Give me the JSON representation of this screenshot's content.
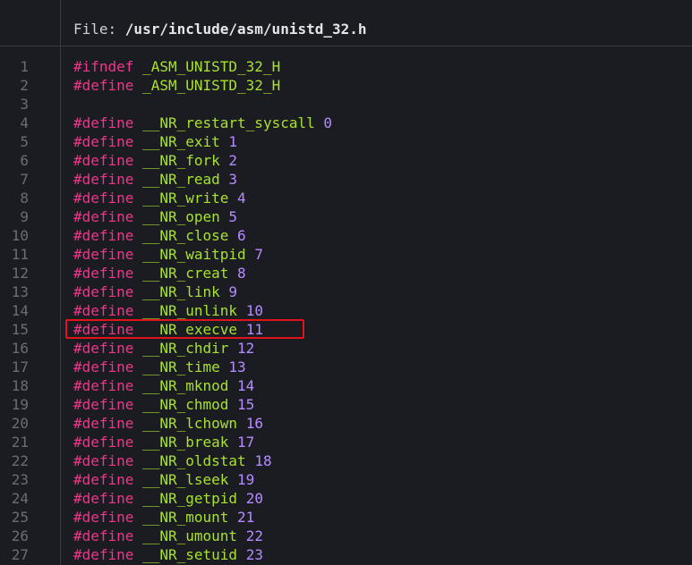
{
  "header": {
    "file_label": "File: ",
    "file_path": "/usr/include/asm/unistd_32.h"
  },
  "code_lines": [
    {
      "n": "1",
      "kw": "#ifndef",
      "id": "_ASM_UNISTD_32_H",
      "num": ""
    },
    {
      "n": "2",
      "kw": "#define",
      "id": "_ASM_UNISTD_32_H",
      "num": ""
    },
    {
      "n": "3",
      "kw": "",
      "id": "",
      "num": ""
    },
    {
      "n": "4",
      "kw": "#define",
      "id": "__NR_restart_syscall",
      "num": "0"
    },
    {
      "n": "5",
      "kw": "#define",
      "id": "__NR_exit",
      "num": "1"
    },
    {
      "n": "6",
      "kw": "#define",
      "id": "__NR_fork",
      "num": "2"
    },
    {
      "n": "7",
      "kw": "#define",
      "id": "__NR_read",
      "num": "3"
    },
    {
      "n": "8",
      "kw": "#define",
      "id": "__NR_write",
      "num": "4"
    },
    {
      "n": "9",
      "kw": "#define",
      "id": "__NR_open",
      "num": "5"
    },
    {
      "n": "10",
      "kw": "#define",
      "id": "__NR_close",
      "num": "6"
    },
    {
      "n": "11",
      "kw": "#define",
      "id": "__NR_waitpid",
      "num": "7"
    },
    {
      "n": "12",
      "kw": "#define",
      "id": "__NR_creat",
      "num": "8"
    },
    {
      "n": "13",
      "kw": "#define",
      "id": "__NR_link",
      "num": "9"
    },
    {
      "n": "14",
      "kw": "#define",
      "id": "__NR_unlink",
      "num": "10"
    },
    {
      "n": "15",
      "kw": "#define",
      "id": "__NR_execve",
      "num": "11"
    },
    {
      "n": "16",
      "kw": "#define",
      "id": "__NR_chdir",
      "num": "12"
    },
    {
      "n": "17",
      "kw": "#define",
      "id": "__NR_time",
      "num": "13"
    },
    {
      "n": "18",
      "kw": "#define",
      "id": "__NR_mknod",
      "num": "14"
    },
    {
      "n": "19",
      "kw": "#define",
      "id": "__NR_chmod",
      "num": "15"
    },
    {
      "n": "20",
      "kw": "#define",
      "id": "__NR_lchown",
      "num": "16"
    },
    {
      "n": "21",
      "kw": "#define",
      "id": "__NR_break",
      "num": "17"
    },
    {
      "n": "22",
      "kw": "#define",
      "id": "__NR_oldstat",
      "num": "18"
    },
    {
      "n": "23",
      "kw": "#define",
      "id": "__NR_lseek",
      "num": "19"
    },
    {
      "n": "24",
      "kw": "#define",
      "id": "__NR_getpid",
      "num": "20"
    },
    {
      "n": "25",
      "kw": "#define",
      "id": "__NR_mount",
      "num": "21"
    },
    {
      "n": "26",
      "kw": "#define",
      "id": "__NR_umount",
      "num": "22"
    },
    {
      "n": "27",
      "kw": "#define",
      "id": "__NR_setuid",
      "num": "23"
    }
  ],
  "highlighted_line": "15",
  "colors": {
    "background": "#1b1c21",
    "keyword": "#f0358b",
    "identifier": "#a8e22e",
    "number": "#b58cff",
    "line_number": "#6b6d76",
    "highlight_border": "#e0141a"
  }
}
